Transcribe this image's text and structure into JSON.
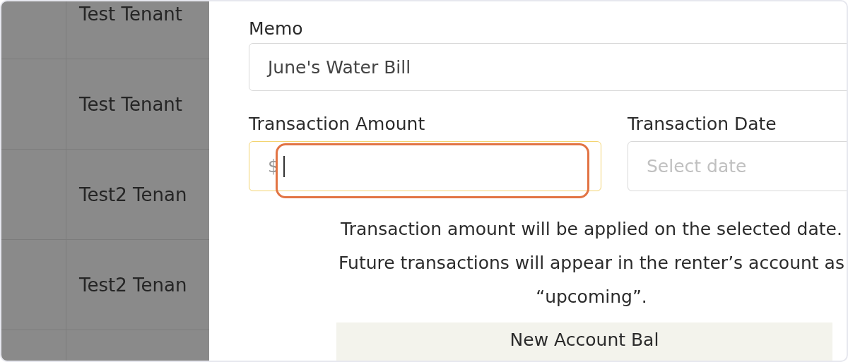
{
  "background_table": {
    "rows": [
      {
        "name": "Test Tenant"
      },
      {
        "name": "Test Tenant"
      },
      {
        "name": "Test2 Tenan"
      },
      {
        "name": "Test2 Tenan"
      },
      {}
    ]
  },
  "form": {
    "memo": {
      "label": "Memo",
      "value": "June's Water Bill"
    },
    "amount": {
      "label": "Transaction Amount",
      "prefix": "$",
      "focused": true,
      "annotated": true
    },
    "date": {
      "label": "Transaction Date",
      "placeholder": "Select date"
    },
    "help_text": "Transaction amount will be applied on the selected date. Future transactions will appear in the renter’s account as “upcoming”.",
    "balance_box": {
      "label": "New Account Bal"
    }
  }
}
